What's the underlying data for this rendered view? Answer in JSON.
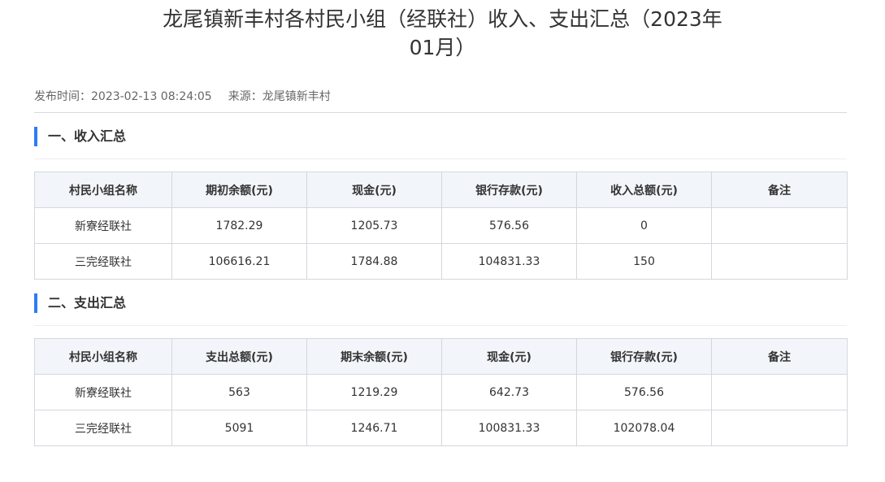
{
  "article": {
    "title_line1": "龙尾镇新丰村各村民小组（经联社）收入、支出汇总（2023年",
    "title_line2": "01月）",
    "publish_time": "发布时间：2023-02-13 08:24:05",
    "source": "来源：龙尾镇新丰村"
  },
  "income": {
    "heading": "一、收入汇总",
    "headers": [
      "村民小组名称",
      "期初余额(元)",
      "现金(元)",
      "银行存款(元)",
      "收入总额(元)",
      "备注"
    ],
    "rows": [
      [
        "新寮经联社",
        "1782.29",
        "1205.73",
        "576.56",
        "0",
        ""
      ],
      [
        "三完经联社",
        "106616.21",
        "1784.88",
        "104831.33",
        "150",
        ""
      ]
    ]
  },
  "expense": {
    "heading": "二、支出汇总",
    "headers": [
      "村民小组名称",
      "支出总额(元)",
      "期末余额(元)",
      "现金(元)",
      "银行存款(元)",
      "备注"
    ],
    "rows": [
      [
        "新寮经联社",
        "563",
        "1219.29",
        "642.73",
        "576.56",
        ""
      ],
      [
        "三完经联社",
        "5091",
        "1246.71",
        "100831.33",
        "102078.04",
        ""
      ]
    ]
  },
  "colors": {
    "accent_bar": "#2e7cf6",
    "table_header_bg": "#f2f5f9",
    "table_border": "#d4d7de"
  }
}
